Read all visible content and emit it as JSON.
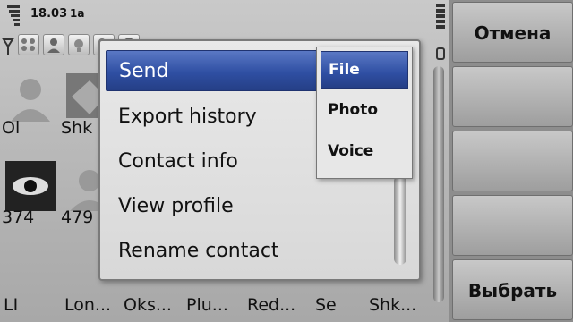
{
  "status": {
    "time": "18.03",
    "network": "1a"
  },
  "contacts": [
    {
      "name": "Ol"
    },
    {
      "name": "Shk"
    },
    {
      "name": "374"
    },
    {
      "name": "479"
    },
    {
      "name": "LI"
    },
    {
      "name": "Lon..."
    },
    {
      "name": "Oks..."
    },
    {
      "name": "Plu..."
    },
    {
      "name": "Red..."
    },
    {
      "name": "Se"
    },
    {
      "name": "Shk..."
    }
  ],
  "menu": {
    "items": [
      {
        "label": "Send"
      },
      {
        "label": "Export history"
      },
      {
        "label": "Contact info"
      },
      {
        "label": "View profile"
      },
      {
        "label": "Rename contact"
      }
    ]
  },
  "submenu": {
    "items": [
      {
        "label": "File"
      },
      {
        "label": "Photo"
      },
      {
        "label": "Voice"
      }
    ]
  },
  "softkeys": {
    "cancel_label": "Отмена",
    "select_label": "Выбрать"
  },
  "colors": {
    "highlight": "#2f4fa3"
  }
}
